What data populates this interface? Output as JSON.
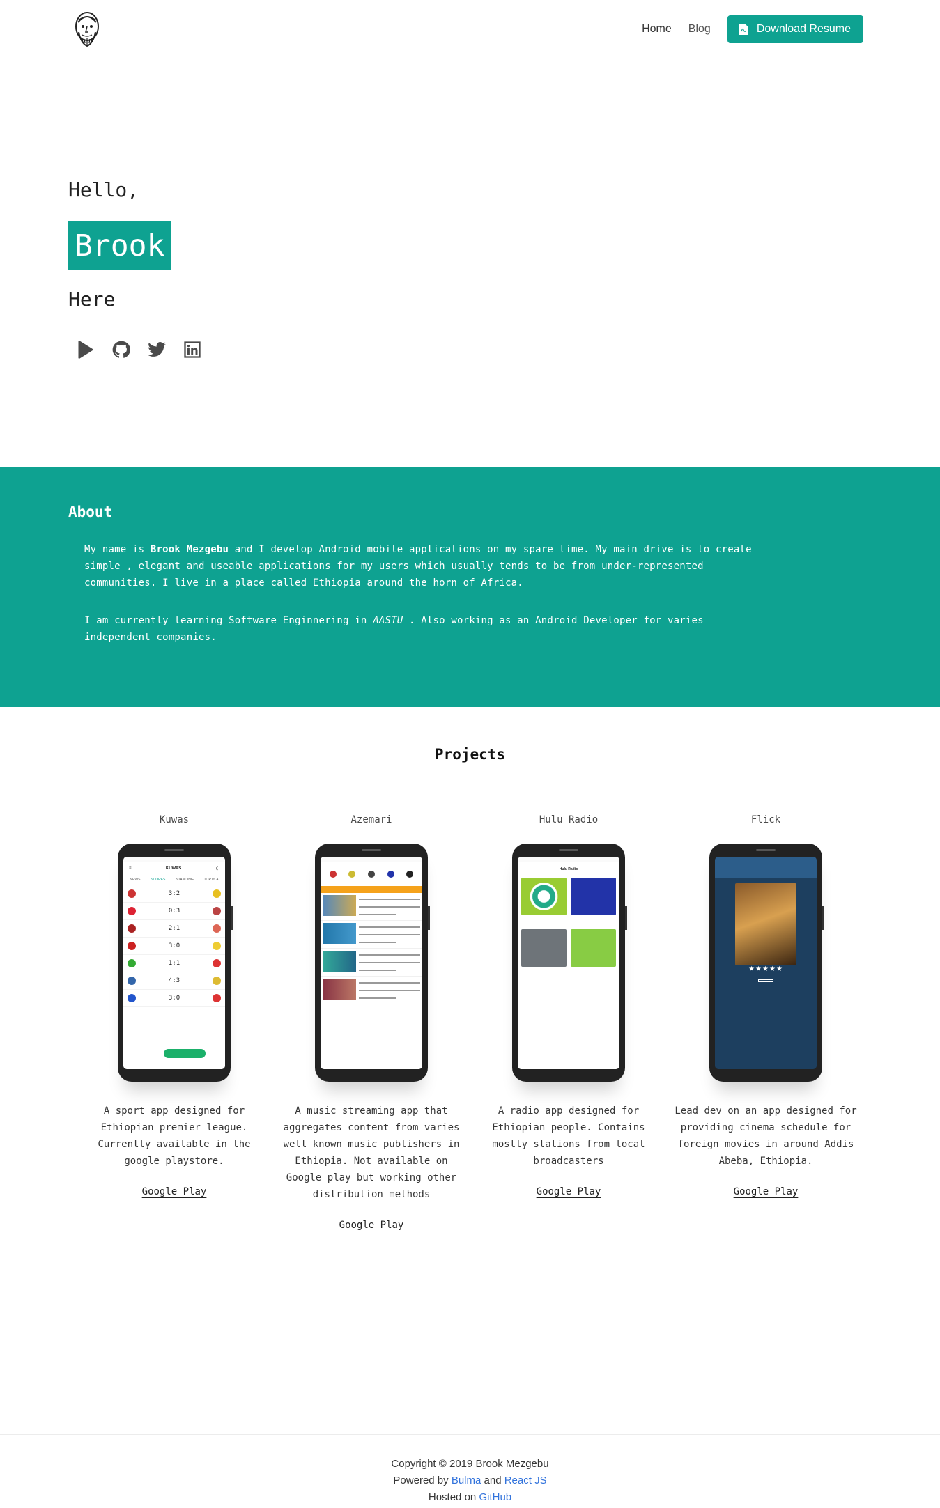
{
  "nav": {
    "home": "Home",
    "blog": "Blog",
    "resume": "Download Resume"
  },
  "hero": {
    "hello": "Hello,",
    "name": "Brook",
    "here": "Here",
    "socials": [
      "google-play-icon",
      "github-icon",
      "twitter-icon",
      "linkedin-icon"
    ]
  },
  "about": {
    "heading": "About",
    "p1_pre": "My name is ",
    "p1_name": "Brook Mezgebu",
    "p1_post": " and I develop Android mobile applications on my spare time. My main drive is to create simple , elegant and useable applications for my users which usually tends to be from under-represented communities. I live in a place called Ethiopia around the horn of Africa.",
    "p2_pre": "I am currently learning Software Enginnering in ",
    "p2_school": "AASTU",
    "p2_post": " . Also working as an Android Developer for varies independent companies."
  },
  "projects": {
    "heading": "Projects",
    "items": [
      {
        "title": "Kuwas",
        "description": "A sport app designed for Ethiopian premier league. Currently available in the google playstore.",
        "link": "Google Play"
      },
      {
        "title": "Azemari",
        "description": "A music streaming app that aggregates content from varies well known music publishers in Ethiopia. Not available on Google play but working other distribution methods",
        "link": "Google Play"
      },
      {
        "title": "Hulu Radio",
        "description": "A radio app designed for Ethiopian people. Contains mostly stations from local broadcasters",
        "link": "Google Play"
      },
      {
        "title": "Flick",
        "description": "Lead dev on an app designed for providing cinema schedule for foreign movies in around Addis Abeba, Ethiopia.",
        "link": "Google Play"
      }
    ]
  },
  "footer": {
    "copyright": "Copyright © 2019 Brook Mezgebu",
    "powered_by": "Powered by",
    "bulma": "Bulma",
    "and": "and",
    "react": "React JS",
    "hosted_on": "Hosted on",
    "github": "GitHub"
  },
  "colors": {
    "accent": "#0ea291",
    "link": "#3273dc"
  }
}
